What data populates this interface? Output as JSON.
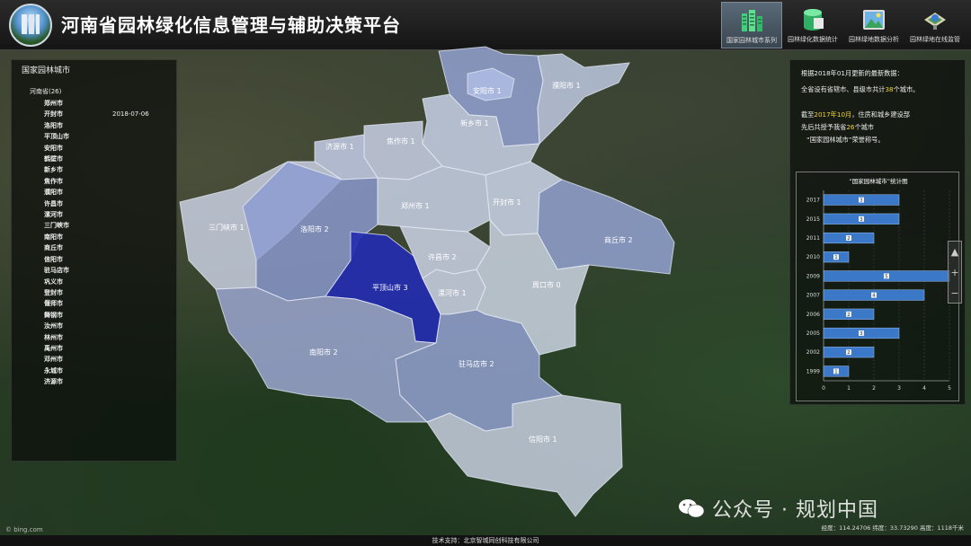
{
  "header": {
    "title": "河南省园林绿化信息管理与辅助决策平台",
    "nav": [
      {
        "label": "国家园林城市系列",
        "icon": "buildings-icon",
        "active": true
      },
      {
        "label": "园林绿化数据统计",
        "icon": "database-icon",
        "active": false
      },
      {
        "label": "园林绿地数据分析",
        "icon": "landscape-icon",
        "active": false
      },
      {
        "label": "园林绿地在线监管",
        "icon": "globe-monitor-icon",
        "active": false
      }
    ]
  },
  "left_panel": {
    "title": "国家园林城市",
    "province": "河南省(26)",
    "date": "2018-07-06",
    "cities": [
      "郑州市",
      "开封市",
      "洛阳市",
      "平顶山市",
      "安阳市",
      "鹤壁市",
      "新乡市",
      "焦作市",
      "濮阳市",
      "许昌市",
      "漯河市",
      "三门峡市",
      "南阳市",
      "商丘市",
      "信阳市",
      "驻马店市",
      "巩义市",
      "登封市",
      "偃师市",
      "舞钢市",
      "汝州市",
      "林州市",
      "禹州市",
      "邓州市",
      "永城市",
      "济源市"
    ]
  },
  "right_panel": {
    "line1": "根据2018年01月更新的最新数据：",
    "line2_pre": "全省设有省辖市、县级市共计",
    "line2_num": "38",
    "line2_post": "个城市。",
    "line3_pre": "截至",
    "line3_date": "2017年10月",
    "line3_post": "，住房和城乡建设部",
    "line4_pre": "先后共授予我省",
    "line4_num": "26",
    "line4_post": "个城市",
    "line5": "“国家园林城市”荣誉称号。"
  },
  "chart_data": {
    "type": "bar",
    "orientation": "horizontal",
    "title": "“国家园林城市”统计图",
    "categories": [
      "2017",
      "2015",
      "2011",
      "2010",
      "2009",
      "2007",
      "2006",
      "2005",
      "2002",
      "1999"
    ],
    "values": [
      3,
      3,
      2,
      1,
      5,
      4,
      2,
      3,
      2,
      1
    ],
    "xlim": [
      0,
      5
    ],
    "xticks": [
      0,
      1,
      2,
      3,
      4,
      5
    ],
    "bar_color": "#3c78c8",
    "data_labels": true
  },
  "map": {
    "labels": {
      "anyang": "安阳市 1",
      "hebi": "鹤壁市 1",
      "puyang": "濮阳市 1",
      "xinxiang": "新乡市 1",
      "jiyuan": "济源市 1",
      "jiaozuo": "焦作市 1",
      "sanmenxia": "三门峡市 1",
      "luoyang": "洛阳市 2",
      "zhengzhou": "郑州市 1",
      "kaifeng": "开封市 1",
      "shangqiu": "商丘市 2",
      "pingdingshan": "平顶山市 3",
      "xuchang": "许昌市 2",
      "luohe": "漯河市 1",
      "zhoukou": "周口市 0",
      "nanyang": "南阳市 2",
      "zhumadian": "驻马店市 2",
      "xinyang": "信阳市 1"
    }
  },
  "footer": {
    "support": "技术支持：北京智城同创科技有限公司",
    "coords": "经度：114.24706  纬度：33.73290  高度：1118千米",
    "bing": "© bing.com"
  },
  "watermark": "公众号 · 规划中国"
}
